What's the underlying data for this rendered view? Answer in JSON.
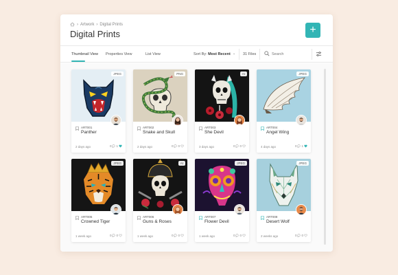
{
  "breadcrumb": {
    "sep": "›",
    "items": [
      "Artwork",
      "Digital Prints"
    ]
  },
  "page_title": "Digital Prints",
  "add_button": "+",
  "tabs": [
    "Thumbnail View",
    "Properties View",
    "List View"
  ],
  "sort": {
    "label": "Sort By:",
    "value": "Most Recent"
  },
  "files_count": "31 Files",
  "search": {
    "placeholder": "Search"
  },
  "colors": {
    "accent": "#32b5b5"
  },
  "cards": [
    {
      "id": "ART001",
      "name": "Panther",
      "date": "2 days ago",
      "format": "JPEG",
      "comments": "0",
      "likes": "1",
      "liked": true,
      "bookmark": "outline"
    },
    {
      "id": "ART002",
      "name": "Snake and Skull",
      "date": "2 days ago",
      "format": "PNG",
      "comments": "0",
      "likes": "0",
      "liked": false,
      "bookmark": "outline"
    },
    {
      "id": "ART003",
      "name": "She Devil",
      "date": "3 days ago",
      "format": "AI",
      "comments": "0",
      "likes": "0",
      "liked": false,
      "bookmark": "outline"
    },
    {
      "id": "ART004",
      "name": "Angel Wing",
      "date": "4 days ago",
      "format": "JPEG",
      "comments": "0",
      "likes": "1",
      "liked": true,
      "bookmark": "accent"
    },
    {
      "id": "ART005",
      "name": "Crowned Tiger",
      "date": "1 week ago",
      "format": "JPEG",
      "comments": "0",
      "likes": "0",
      "liked": false,
      "bookmark": "outline"
    },
    {
      "id": "ART006",
      "name": "Guns & Roses",
      "date": "1 week ago",
      "format": "AI",
      "comments": "0",
      "likes": "0",
      "liked": false,
      "bookmark": "outline"
    },
    {
      "id": "ART007",
      "name": "Flower Devil",
      "date": "1 week ago",
      "format": "JPEG",
      "comments": "0",
      "likes": "0",
      "liked": false,
      "bookmark": "accent"
    },
    {
      "id": "ART008",
      "name": "Desert Wolf",
      "date": "2 weeks ago",
      "format": "JPEG",
      "comments": "0",
      "likes": "0",
      "liked": false,
      "bookmark": "accent"
    }
  ]
}
